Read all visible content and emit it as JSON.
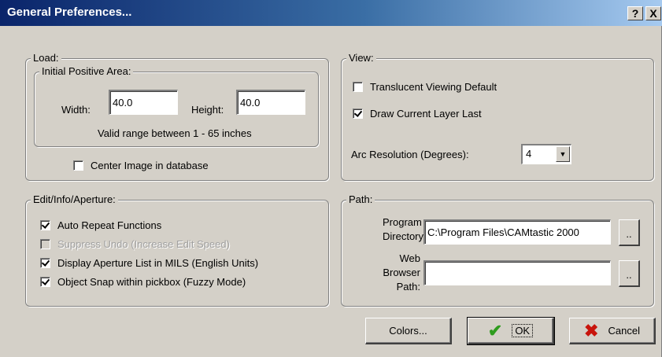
{
  "window": {
    "title": "General Preferences...",
    "help_label": "?",
    "close_label": "X"
  },
  "load": {
    "legend": "Load:",
    "initial_area": {
      "legend": "Initial Positive Area:",
      "width_label": "Width:",
      "width_value": "40.0",
      "height_label": "Height:",
      "height_value": "40.0",
      "range_text": "Valid range between 1 - 65 inches"
    },
    "center_image": {
      "label": "Center Image in database",
      "checked": false
    }
  },
  "view": {
    "legend": "View:",
    "translucent": {
      "label": "Translucent Viewing Default",
      "checked": false
    },
    "draw_current": {
      "label": "Draw Current Layer Last",
      "checked": true
    },
    "arc_label": "Arc Resolution (Degrees):",
    "arc_value": "4"
  },
  "edit": {
    "legend": "Edit/Info/Aperture:",
    "items": [
      {
        "label": "Auto Repeat Functions",
        "checked": true,
        "disabled": false
      },
      {
        "label": "Suppress Undo (Increase Edit Speed)",
        "checked": false,
        "disabled": true
      },
      {
        "label": "Display Aperture List in MILS (English Units)",
        "checked": true,
        "disabled": false
      },
      {
        "label": "Object Snap within pickbox (Fuzzy Mode)",
        "checked": true,
        "disabled": false
      }
    ]
  },
  "path": {
    "legend": "Path:",
    "program_label_1": "Program",
    "program_label_2": "Directory:",
    "program_value": "C:\\Program Files\\CAMtastic 2000",
    "web_label_1": "Web",
    "web_label_2": "Browser",
    "web_label_3": "Path:",
    "web_value": "",
    "browse_label": ".."
  },
  "buttons": {
    "colors": "Colors...",
    "ok": "OK",
    "cancel": "Cancel",
    "ok_icon": "✔",
    "cancel_icon": "✖"
  },
  "colors": {
    "ok_icon": "#2e9c1e",
    "cancel_icon": "#c8140c",
    "titlebar_start": "#0a246a"
  }
}
